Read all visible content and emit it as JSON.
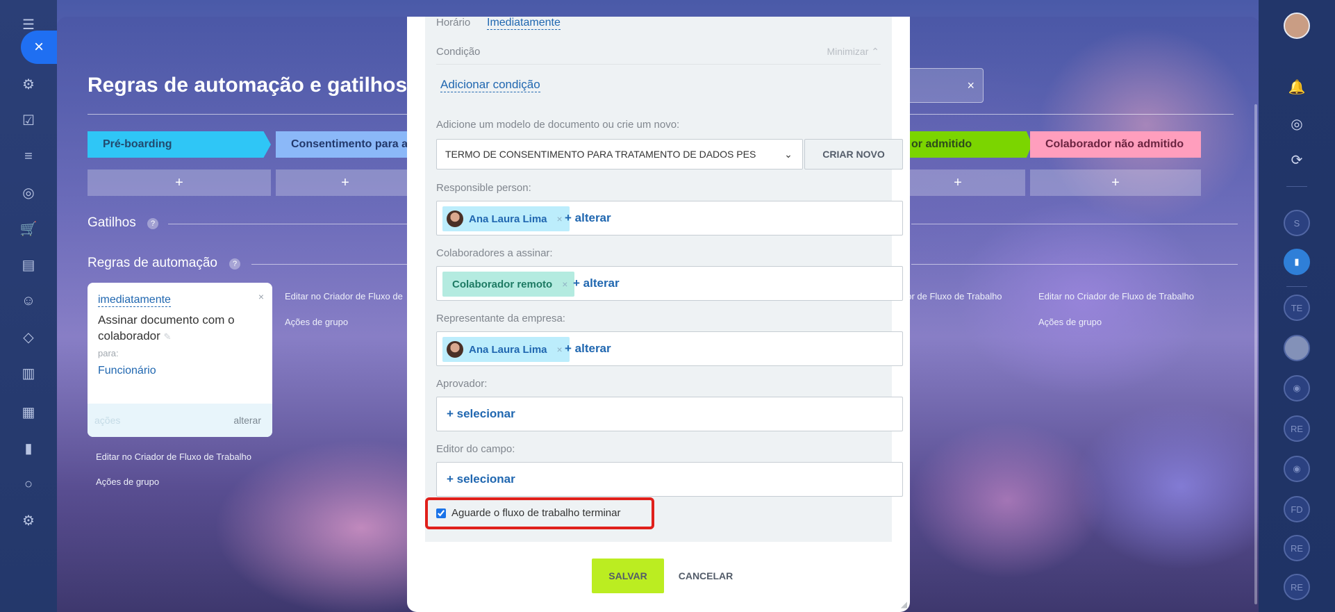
{
  "page": {
    "title": "Regras de automação e gatilhos",
    "stages": [
      {
        "label": "Pré-boarding",
        "color": "#2fc6f6"
      },
      {
        "label": "Consentimento para as",
        "color": "#8bb8f8"
      },
      {
        "label": "or admitido",
        "color": "#7bd500"
      },
      {
        "label": "Colaborador não admitido",
        "color": "#ff9ebd"
      }
    ],
    "add_symbol": "+",
    "triggers_title": "Gatilhos",
    "rules_title": "Regras de automação",
    "help_symbol": "?",
    "search_clear": "×",
    "rule_card": {
      "when": "imediatamente",
      "text": "Assinar documento com o colaborador",
      "for_label": "para:",
      "who": "Funcionário",
      "actions_label": "ações",
      "edit_label": "alterar",
      "close": "×"
    },
    "links": {
      "edit_workflow": "Editar no Criador de Fluxo de Trabalho",
      "edit_workflow_cut_a": "Editar no Criador de Fluxo de",
      "edit_workflow_cut_b": "dor de Fluxo de Trabalho",
      "group_actions": "Ações de grupo",
      "group_actions_cut": "o"
    }
  },
  "modal": {
    "time_label": "Horário",
    "time_value": "Imediatamente",
    "condition_label": "Condição",
    "minimize_label": "Minimizar",
    "add_condition": "Adicionar condição",
    "template_label": "Adicione um modelo de documento ou crie um novo:",
    "template_value": "TERMO DE CONSENTIMENTO PARA TRATAMENTO DE DADOS PES",
    "create_new": "CRIAR NOVO",
    "responsible_label": "Responsible person:",
    "responsible_value": "Ana Laura Lima",
    "signers_label": "Colaboradores a assinar:",
    "signers_value": "Colaborador remoto",
    "company_rep_label": "Representante da empresa:",
    "company_rep_value": "Ana Laura Lima",
    "approver_label": "Aprovador:",
    "field_editor_label": "Editor do campo:",
    "alter_link": "+ alterar",
    "select_link": "+ selecionar",
    "chip_remove": "×",
    "wait_label": "Aguarde o fluxo de trabalho terminar",
    "wait_checked": true,
    "save": "SALVAR",
    "cancel": "CANCELAR"
  },
  "right_rail": {
    "badges": [
      "S",
      "TE",
      "RE",
      "FD",
      "RE",
      "RE"
    ]
  },
  "close_symbol": "×"
}
